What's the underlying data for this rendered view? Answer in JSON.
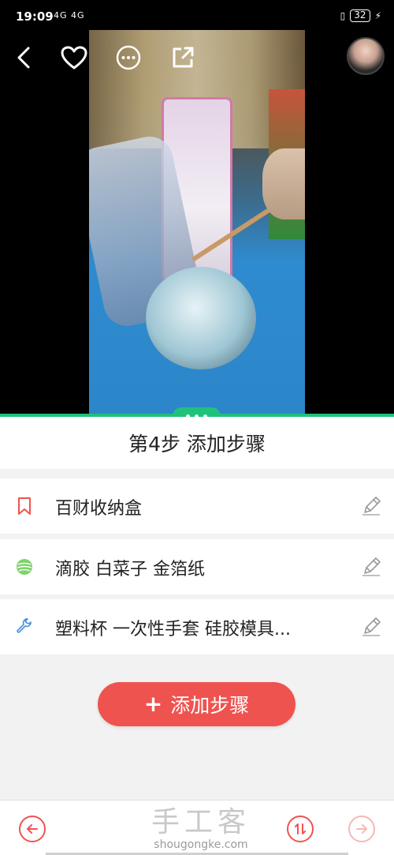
{
  "status_bar": {
    "time": "19:09",
    "network": "4G 4G",
    "battery": "32"
  },
  "header": {
    "icons": [
      "back-icon",
      "heart-icon",
      "more-icon",
      "share-icon",
      "avatar"
    ]
  },
  "step": {
    "title": "第4步 添加步骤"
  },
  "rows": [
    {
      "icon": "bookmark-icon",
      "text": "百财收纳盒"
    },
    {
      "icon": "yarn-ball-icon",
      "text": "滴胶  白菜子  金箔纸"
    },
    {
      "icon": "wrench-icon",
      "text": "塑料杯  一次性手套  硅胶模具..."
    }
  ],
  "actions": {
    "add_step": "添加步骤"
  },
  "footer": {
    "logo_cn": "手工客",
    "logo_en": "shougongke.com"
  },
  "colors": {
    "accent_red": "#ef5350",
    "accent_green": "#1fc27a"
  }
}
